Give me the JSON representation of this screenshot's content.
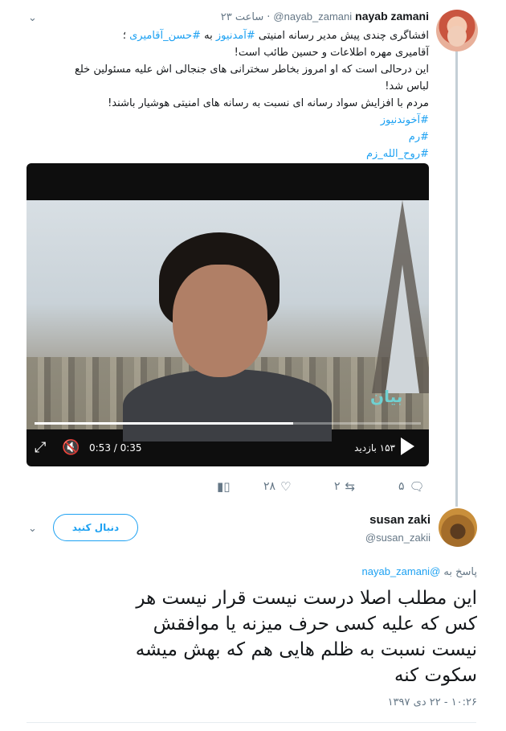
{
  "tweet1": {
    "name": "nayab zamani",
    "handle": "@nayab_zamani",
    "time": "۲۳ ساعت",
    "lines": [
      "افشاگری چندی پیش مدیر رسانه امنیتی ",
      "آقامیری مهره اطلاعات و حسین طائب است!",
      "این درحالی است که او امروز بخاطر سخترانی های جنجالی اش علیه مسئولین خلع",
      "لباس شد!",
      "مردم با افزایش سواد رسانه ای نسبت به رسانه های امنیتی هوشیار باشند!"
    ],
    "line1_tag1": "#آمدنیوز",
    "line1_mid": " به ",
    "line1_tag2": "#حسن_آقامیری",
    "line1_end": " ؛",
    "hashtags": [
      "#آخوندنیوز",
      "#رم",
      "#روح_الله_زم"
    ],
    "video": {
      "time": "0:53 / 0:35",
      "views": "۱۵۳ بازدید",
      "progress": 0.67,
      "logo": "بیان"
    },
    "actions": {
      "replies": "۵",
      "retweets": "۲",
      "likes": "۲۸"
    }
  },
  "tweet2": {
    "name": "susan zaki",
    "handle": "@susan_zakii",
    "follow_label": "دنبال کنید",
    "reply_prefix": "پاسخ به",
    "reply_mention": "@nayab_zamani",
    "lines": [
      "این مطلب اصلا درست نیست قرار نیست هر",
      "کس که علیه کسی حرف میزنه یا موافقش",
      "نیست نسبت به ظلم هایی هم که بهش میشه",
      "سکوت کنه"
    ],
    "timestamp": "۱۰:۲۶ - ۲۲ دی ۱۳۹۷"
  },
  "icons": [
    "chevron-down-icon",
    "expand-icon",
    "mute-icon",
    "play-icon",
    "reply-icon",
    "retweet-icon",
    "like-icon",
    "analytics-icon"
  ],
  "colors": {
    "link": "#1da1f2",
    "muted": "#657786",
    "text": "#14171a"
  }
}
